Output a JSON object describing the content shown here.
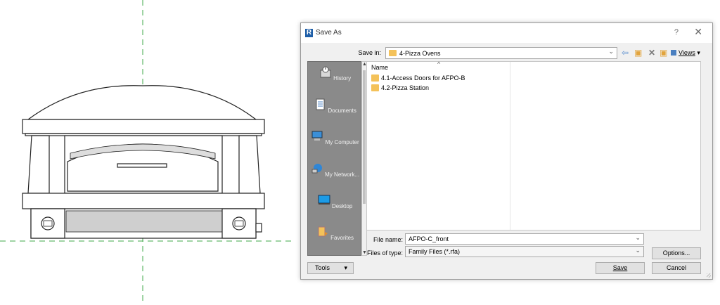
{
  "dialog": {
    "title": "Save As",
    "app_icon_letter": "R",
    "help_glyph": "?",
    "close_glyph": "✕"
  },
  "save_in": {
    "label": "Save in:",
    "value": "4-Pizza Ovens"
  },
  "toolbar": {
    "views_label": "Views"
  },
  "places": [
    {
      "label": "History",
      "icon": "history-icon"
    },
    {
      "label": "Documents",
      "icon": "documents-icon"
    },
    {
      "label": "My Computer",
      "icon": "computer-icon"
    },
    {
      "label": "My Network...",
      "icon": "network-icon"
    },
    {
      "label": "Desktop",
      "icon": "desktop-icon"
    },
    {
      "label": "Favorites",
      "icon": "favorites-icon"
    }
  ],
  "file_list": {
    "column_name": "Name",
    "items": [
      {
        "name": "4.1-Access Doors for AFPO-B",
        "icon": "folder-icon"
      },
      {
        "name": "4.2-Pizza Station",
        "icon": "folder-icon"
      }
    ]
  },
  "file_name": {
    "label": "File name:",
    "value": "AFPO-C_front"
  },
  "file_type": {
    "label": "Files of type:",
    "value": "Family Files  (*.rfa)"
  },
  "buttons": {
    "options": "Options...",
    "save": "Save",
    "cancel": "Cancel",
    "tools": "Tools"
  },
  "colors": {
    "reference_line": "#3fa84a",
    "drawing_line": "#222222",
    "places_bg": "#8a8a8a",
    "folder": "#f4c25a",
    "brand": "#1f5fa8"
  }
}
